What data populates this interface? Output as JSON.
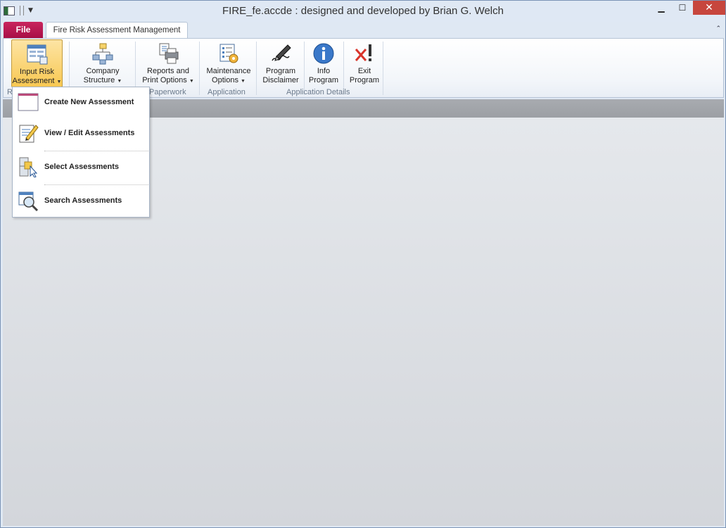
{
  "window": {
    "title": "FIRE_fe.accde : designed and developed by Brian G. Welch"
  },
  "tabs": {
    "file": "File",
    "main": "Fire Risk Assessment Management"
  },
  "ribbon": {
    "buttons": {
      "input_risk": {
        "line1": "Input Risk",
        "line2": "Assessment"
      },
      "company": {
        "line1": "Company",
        "line2": "Structure"
      },
      "reports": {
        "line1": "Reports and",
        "line2": "Print Options"
      },
      "maintenance": {
        "line1": "Maintenance",
        "line2": "Options"
      },
      "disclaimer": {
        "line1": "Program",
        "line2": "Disclaimer"
      },
      "info": {
        "line1": "Info",
        "line2": "Program"
      },
      "exit": {
        "line1": "Exit",
        "line2": "Program"
      }
    },
    "groups": {
      "first": "R",
      "paperwork": "Paperwork",
      "application": "Application",
      "details": "Application Details"
    }
  },
  "menu": {
    "items": [
      {
        "label": "Create New Assessment",
        "icon": "new-form-icon"
      },
      {
        "label": "View / Edit Assessments",
        "icon": "edit-pencil-icon"
      },
      {
        "label": "Select Assessments",
        "icon": "select-pointer-icon"
      },
      {
        "label": "Search Assessments",
        "icon": "search-magnifier-icon"
      }
    ]
  },
  "colors": {
    "file_tab": "#b81a52",
    "close_button": "#c7463d",
    "active_button": "#f8c852"
  }
}
